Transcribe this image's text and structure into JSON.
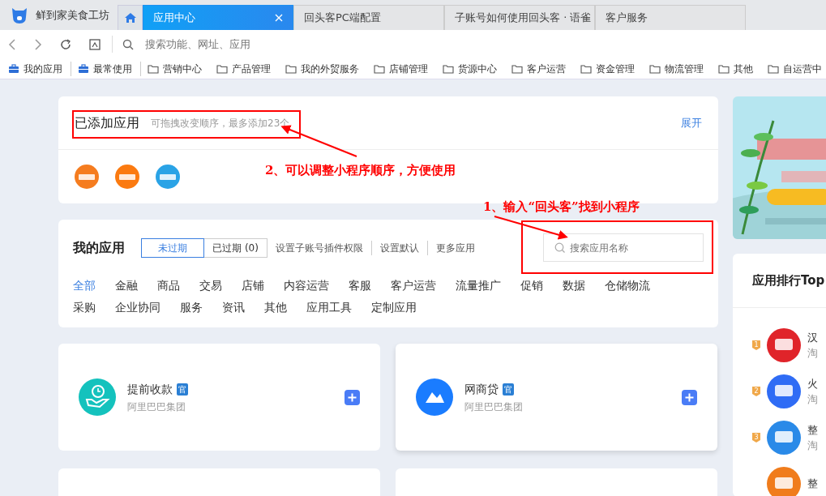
{
  "browser": {
    "app_name": "鲜到家美食工坊",
    "tabs": [
      {
        "label": "应用中心",
        "selected": true
      },
      {
        "label": "回头客PC端配置",
        "selected": false
      },
      {
        "label": "子账号如何使用回头客 · 语雀",
        "selected": false
      },
      {
        "label": "客户服务",
        "selected": false
      }
    ],
    "address_placeholder": "搜索功能、网址、应用",
    "bookmarks": [
      {
        "label": "我的应用",
        "kind": "app"
      },
      {
        "label": "最常使用",
        "kind": "app"
      },
      {
        "label": "营销中心",
        "kind": "folder"
      },
      {
        "label": "产品管理",
        "kind": "folder"
      },
      {
        "label": "我的外贸服务",
        "kind": "folder"
      },
      {
        "label": "店铺管理",
        "kind": "folder"
      },
      {
        "label": "货源中心",
        "kind": "folder"
      },
      {
        "label": "客户运营",
        "kind": "folder"
      },
      {
        "label": "资金管理",
        "kind": "folder"
      },
      {
        "label": "物流管理",
        "kind": "folder"
      },
      {
        "label": "其他",
        "kind": "folder"
      },
      {
        "label": "自运营中",
        "kind": "folder"
      }
    ]
  },
  "added_apps": {
    "title": "已添加应用",
    "hint": "可拖拽改变顺序，最多添加23个",
    "expand": "展开",
    "apps": [
      {
        "color": "#f57c1f"
      },
      {
        "color": "#fb7a10"
      },
      {
        "color": "#2aa3e6"
      }
    ]
  },
  "my_apps": {
    "title": "我的应用",
    "filters": [
      {
        "label": "未过期",
        "selected": true
      },
      {
        "label": "已过期 (0)",
        "selected": false
      }
    ],
    "links": [
      "设置子账号插件权限",
      "设置默认",
      "更多应用"
    ],
    "search_placeholder": "搜索应用名称",
    "categories": [
      {
        "label": "全部",
        "selected": true
      },
      {
        "label": "金融",
        "selected": false
      },
      {
        "label": "商品",
        "selected": false
      },
      {
        "label": "交易",
        "selected": false
      },
      {
        "label": "店铺",
        "selected": false
      },
      {
        "label": "内容运营",
        "selected": false
      },
      {
        "label": "客服",
        "selected": false
      },
      {
        "label": "客户运营",
        "selected": false
      },
      {
        "label": "流量推广",
        "selected": false
      },
      {
        "label": "促销",
        "selected": false
      },
      {
        "label": "数据",
        "selected": false
      },
      {
        "label": "仓储物流",
        "selected": false
      },
      {
        "label": "采购",
        "selected": false
      },
      {
        "label": "企业协同",
        "selected": false
      },
      {
        "label": "服务",
        "selected": false
      },
      {
        "label": "资讯",
        "selected": false
      },
      {
        "label": "其他",
        "selected": false
      },
      {
        "label": "应用工具",
        "selected": false
      },
      {
        "label": "定制应用",
        "selected": false
      }
    ]
  },
  "app_cards": [
    {
      "kind": "app",
      "name": "提前收款",
      "badge": "官",
      "vendor": "阿里巴巴集团",
      "color": "#14c2bd"
    },
    {
      "kind": "app",
      "name": "网商贷",
      "badge": "官",
      "vendor": "阿里巴巴集团",
      "color": "#1a7cff"
    },
    {
      "kind": "blank"
    },
    {
      "kind": "blank"
    }
  ],
  "ranking": {
    "title": "应用排行Top",
    "items": [
      {
        "rank": "1",
        "name": "汉",
        "vendor": "淘",
        "color": "#e0242a"
      },
      {
        "rank": "2",
        "name": "火",
        "vendor": "淘",
        "color": "#2f6cf5"
      },
      {
        "rank": "3",
        "name": "整",
        "vendor": "淘",
        "color": "#2a8ae8"
      },
      {
        "name": "整",
        "color": "#f07c1c"
      }
    ]
  },
  "annotations": [
    {
      "text": "2、可以调整小程序顺序，方便使用"
    },
    {
      "text": "1、输入“回头客”找到小程序"
    }
  ]
}
